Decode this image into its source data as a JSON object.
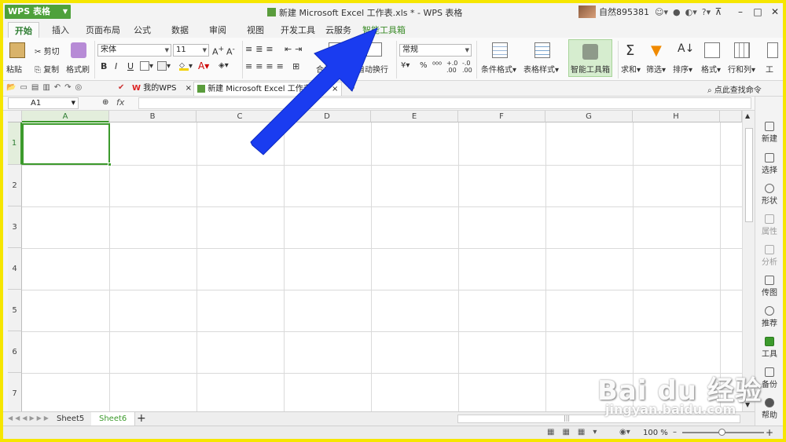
{
  "app": {
    "button_label": "WPS 表格",
    "window_title": "新建 Microsoft Excel 工作表.xls * - WPS 表格",
    "user_name": "自然895381"
  },
  "tabs": [
    {
      "label": "开始"
    },
    {
      "label": "插入"
    },
    {
      "label": "页面布局"
    },
    {
      "label": "公式"
    },
    {
      "label": "数据"
    },
    {
      "label": "审阅"
    },
    {
      "label": "视图"
    },
    {
      "label": "开发工具"
    },
    {
      "label": "云服务"
    },
    {
      "label": "智能工具箱"
    }
  ],
  "ribbon": {
    "paste": "粘贴",
    "cut": "剪切",
    "copy": "复制",
    "format_painter": "格式刷",
    "font_name": "宋体",
    "font_size": "11",
    "bold": "B",
    "italic": "I",
    "underline": "U",
    "merge_center": "合并居中",
    "wrap_text": "自动换行",
    "number_format": "常规",
    "percent": "%",
    "conditional_format": "条件格式",
    "table_style": "表格样式",
    "smart_toolbox": "智能工具箱",
    "sum": "求和",
    "filter": "筛选",
    "sort": "排序",
    "format": "格式",
    "rows_cols": "行和列",
    "worksheet": "工"
  },
  "doc_tabs": {
    "my_wps": "我的WPS",
    "current_doc": "新建 Microsoft Excel 工作表.xls",
    "search_cmd": "点此查找命令"
  },
  "formula_bar": {
    "name_box": "A1",
    "fx": "fx"
  },
  "grid": {
    "columns": [
      "A",
      "B",
      "C",
      "D",
      "E",
      "F",
      "G",
      "H"
    ],
    "rows": [
      "1",
      "2",
      "3",
      "4",
      "5",
      "6",
      "7"
    ]
  },
  "sheets": [
    {
      "name": "Sheet5"
    },
    {
      "name": "Sheet6"
    }
  ],
  "status": {
    "zoom": "100 %"
  },
  "side_panel": [
    {
      "label": "新建"
    },
    {
      "label": "选择"
    },
    {
      "label": "形状"
    },
    {
      "label": "属性"
    },
    {
      "label": "分析"
    },
    {
      "label": "传图"
    },
    {
      "label": "推荐"
    },
    {
      "label": "工具"
    },
    {
      "label": "备份"
    },
    {
      "label": "帮助"
    }
  ],
  "watermark": {
    "main": "Bai du 经验",
    "sub": "jingyan.baidu.com"
  },
  "colors": {
    "accent_green": "#3c9a2c",
    "arrow_blue": "#1a3cf0",
    "frame_yellow": "#f6e600"
  }
}
